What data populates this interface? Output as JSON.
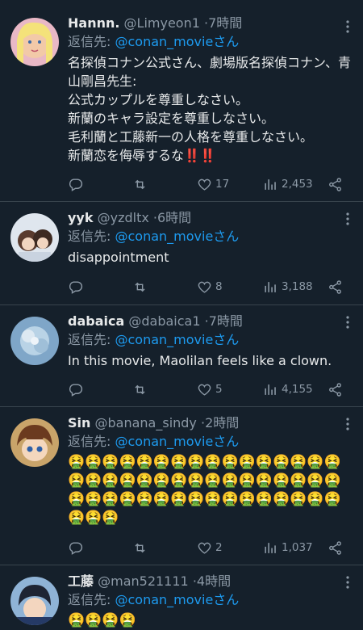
{
  "tweets": [
    {
      "name": "Hannn.",
      "handle": "@Limyeon1",
      "dot": "·",
      "time": "7時間",
      "reply_prefix": "返信先:",
      "reply_mention": "@conan_movieさん",
      "text": "名探偵コナン公式さん、劇場版名探偵コナン、青山剛昌先生:\n公式カップルを尊重しなさい。\n新蘭のキャラ設定を尊重しなさい。\n毛利蘭と工藤新一の人格を尊重しなさい。\n新蘭恋を侮辱するな‼️‼️",
      "replies": "",
      "retweets": "",
      "likes": "17",
      "views": "2,453"
    },
    {
      "name": "yyk",
      "handle": "@yzdltx",
      "dot": "·",
      "time": "6時間",
      "reply_prefix": "返信先:",
      "reply_mention": "@conan_movieさん",
      "text": "disappointment",
      "replies": "",
      "retweets": "",
      "likes": "8",
      "views": "3,188"
    },
    {
      "name": "dabaica",
      "handle": "@dabaica1",
      "dot": "·",
      "time": "7時間",
      "reply_prefix": "返信先:",
      "reply_mention": "@conan_movieさん",
      "text": "In this movie, Maolilan feels like a clown.",
      "replies": "",
      "retweets": "",
      "likes": "5",
      "views": "4,155"
    },
    {
      "name": "Sin",
      "handle": "@banana_sindy",
      "dot": "·",
      "time": "2時間",
      "reply_prefix": "返信先:",
      "reply_mention": "@conan_movieさん",
      "text": "🤮🤮🤮🤮🤮🤮🤮🤮🤮🤮🤮🤮🤮🤮🤮🤮🤮🤮🤮🤮🤮🤮🤮🤮🤮🤮🤮🤮🤮🤮🤮🤮🤮🤮🤮🤮🤮🤮🤮🤮🤮🤮🤮🤮🤮🤮🤮🤮🤮🤮🤮",
      "replies": "",
      "retweets": "",
      "likes": "2",
      "views": "1,037"
    },
    {
      "name": "工藤",
      "handle": "@man521111",
      "dot": "·",
      "time": "4時間",
      "reply_prefix": "返信先:",
      "reply_mention": "@conan_movieさん",
      "text": "🤮🤮🤮🤮"
    }
  ],
  "icons": {
    "reply": "speech-bubble-icon",
    "retweet": "retweet-icon",
    "like": "heart-icon",
    "views": "bar-chart-icon",
    "share": "share-icon",
    "more": "more-dots-icon"
  },
  "colors": {
    "background": "#15202b",
    "accent": "#1d9bf0",
    "muted": "#8b98a5",
    "text": "#e7e9ea",
    "divider": "#38444d"
  }
}
